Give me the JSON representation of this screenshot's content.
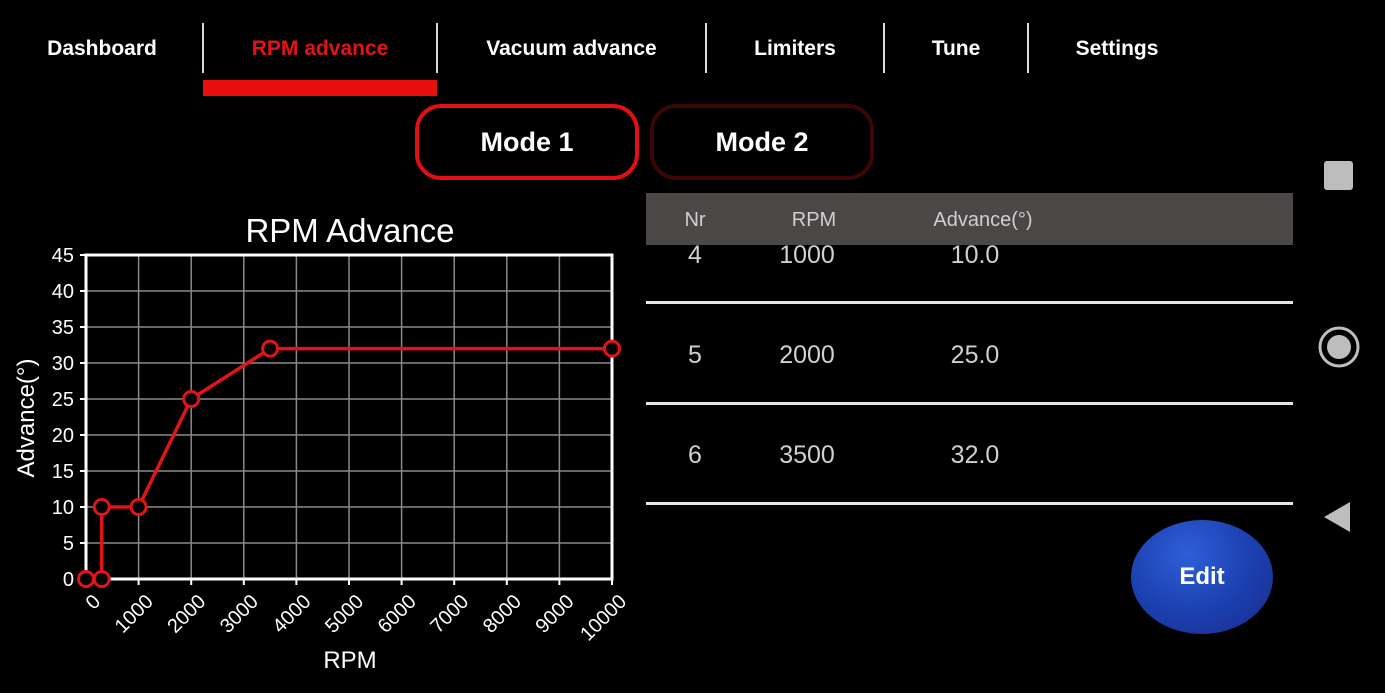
{
  "tabs": [
    {
      "label": "Dashboard",
      "active": false
    },
    {
      "label": "RPM advance",
      "active": true
    },
    {
      "label": "Vacuum advance",
      "active": false
    },
    {
      "label": "Limiters",
      "active": false
    },
    {
      "label": "Tune",
      "active": false
    },
    {
      "label": "Settings",
      "active": false
    }
  ],
  "modes": [
    {
      "label": "Mode 1",
      "active": true
    },
    {
      "label": "Mode 2",
      "active": false
    }
  ],
  "table": {
    "headers": [
      "Nr",
      "RPM",
      "Advance(°)"
    ],
    "rows": [
      {
        "nr": "4",
        "rpm": "1000",
        "advance": "10.0"
      },
      {
        "nr": "5",
        "rpm": "2000",
        "advance": "25.0"
      },
      {
        "nr": "6",
        "rpm": "3500",
        "advance": "32.0"
      }
    ]
  },
  "edit_label": "Edit",
  "colors": {
    "accent": "#e8100f",
    "background": "#000000",
    "edit_button": "#1f45b8"
  },
  "nav_icons": [
    "recents-square-icon",
    "home-circle-icon",
    "back-triangle-icon"
  ],
  "chart_data": {
    "type": "line",
    "title": "RPM Advance",
    "xlabel": "RPM",
    "ylabel": "Advance(°)",
    "x": [
      0,
      300,
      300,
      1000,
      2000,
      3500,
      10000
    ],
    "y": [
      0,
      0,
      10,
      10,
      25,
      32,
      32
    ],
    "xlim": [
      0,
      10000
    ],
    "ylim": [
      0,
      45
    ],
    "xticks": [
      0,
      1000,
      2000,
      3000,
      4000,
      5000,
      6000,
      7000,
      8000,
      9000,
      10000
    ],
    "yticks": [
      0,
      5,
      10,
      15,
      20,
      25,
      30,
      35,
      40,
      45
    ],
    "grid": true,
    "color": "#e01616"
  }
}
